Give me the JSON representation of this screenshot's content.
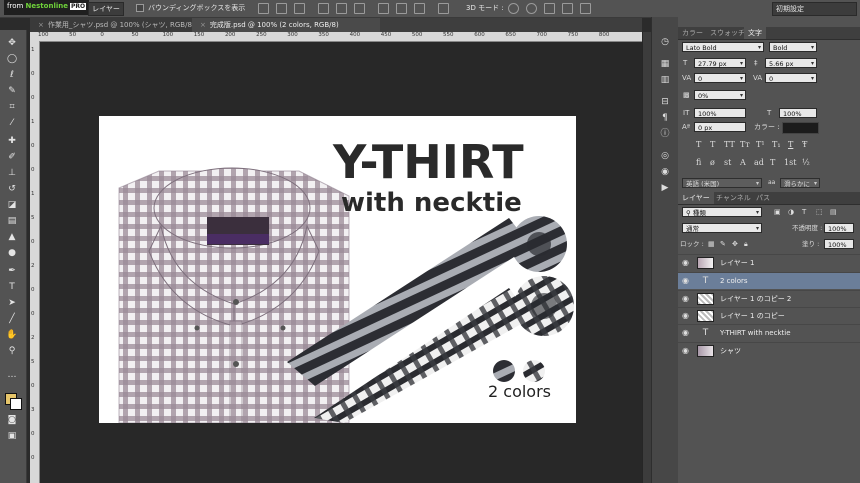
{
  "branding": {
    "from": "from",
    "brand": "Nestonline",
    "badge": "PRO"
  },
  "optionbar": {
    "layer_select": "レイヤー",
    "bounding_box_label": "バウンディングボックスを表示",
    "mode_3d": "3D モード :",
    "workspace_preset": "初期設定"
  },
  "tabs": [
    {
      "label": "作業用_シャツ.psd @ 100% (シャツ, RGB/8)"
    },
    {
      "label": "完成版.psd @ 100% (2 colors, RGB/8)"
    }
  ],
  "ruler": {
    "top": [
      "100",
      "50",
      "0",
      "50",
      "100",
      "150",
      "200",
      "250",
      "300",
      "350",
      "400",
      "450",
      "500",
      "550",
      "600",
      "650",
      "700",
      "750",
      "800"
    ],
    "left": [
      "1",
      "0",
      "0",
      "1",
      "0",
      "0",
      "1",
      "5",
      "0",
      "2",
      "0",
      "0",
      "2",
      "5",
      "0",
      "3",
      "0",
      "0"
    ]
  },
  "canvas": {
    "headline": "Y-THIRT",
    "subline": "with necktie",
    "colors_label": "2 colors"
  },
  "character_panel": {
    "tabs": [
      "カラー",
      "スウォッチ",
      "文字"
    ],
    "font_family": "Lato Bold",
    "font_style": "Bold",
    "size": "27.79 px",
    "leading": "5.66 px",
    "kerning": "0",
    "tracking": "0",
    "tsume": "0%",
    "vscale": "100%",
    "hscale": "100%",
    "baseline": "0 px",
    "color_label": "カラー :",
    "glyph_buttons": [
      "T",
      "T",
      "TT",
      "Tт",
      "T¹",
      "T₁",
      "T",
      "Ŧ"
    ],
    "glyph_buttons2": [
      "ﬁ",
      "ø",
      "st",
      "A",
      "ad",
      "T",
      "1st",
      "½"
    ],
    "language": "英語 (米国)",
    "antialias": "滑らかに"
  },
  "layers_panel": {
    "tabs": [
      "レイヤー",
      "チャンネル",
      "パス"
    ],
    "kind_filter": "種類",
    "blend_mode": "通常",
    "opacity_label": "不透明度 :",
    "opacity": "100%",
    "lock_label": "ロック :",
    "fill_label": "塗り :",
    "fill": "100%",
    "layers": [
      {
        "name": "レイヤー 1",
        "type": "image",
        "selected": false
      },
      {
        "name": "2 colors",
        "type": "text",
        "selected": true
      },
      {
        "name": "レイヤー 1 のコピー 2",
        "type": "pixel",
        "selected": false
      },
      {
        "name": "レイヤー 1 のコピー",
        "type": "pixel",
        "selected": false
      },
      {
        "name": "Y-THIRT  with necktie",
        "type": "text",
        "selected": false
      },
      {
        "name": "シャツ",
        "type": "image",
        "selected": false
      }
    ]
  },
  "colors": {
    "selection": "#6b7e99",
    "foreground": "#e6c56a",
    "background": "#ffffff",
    "panel": "#535353"
  }
}
